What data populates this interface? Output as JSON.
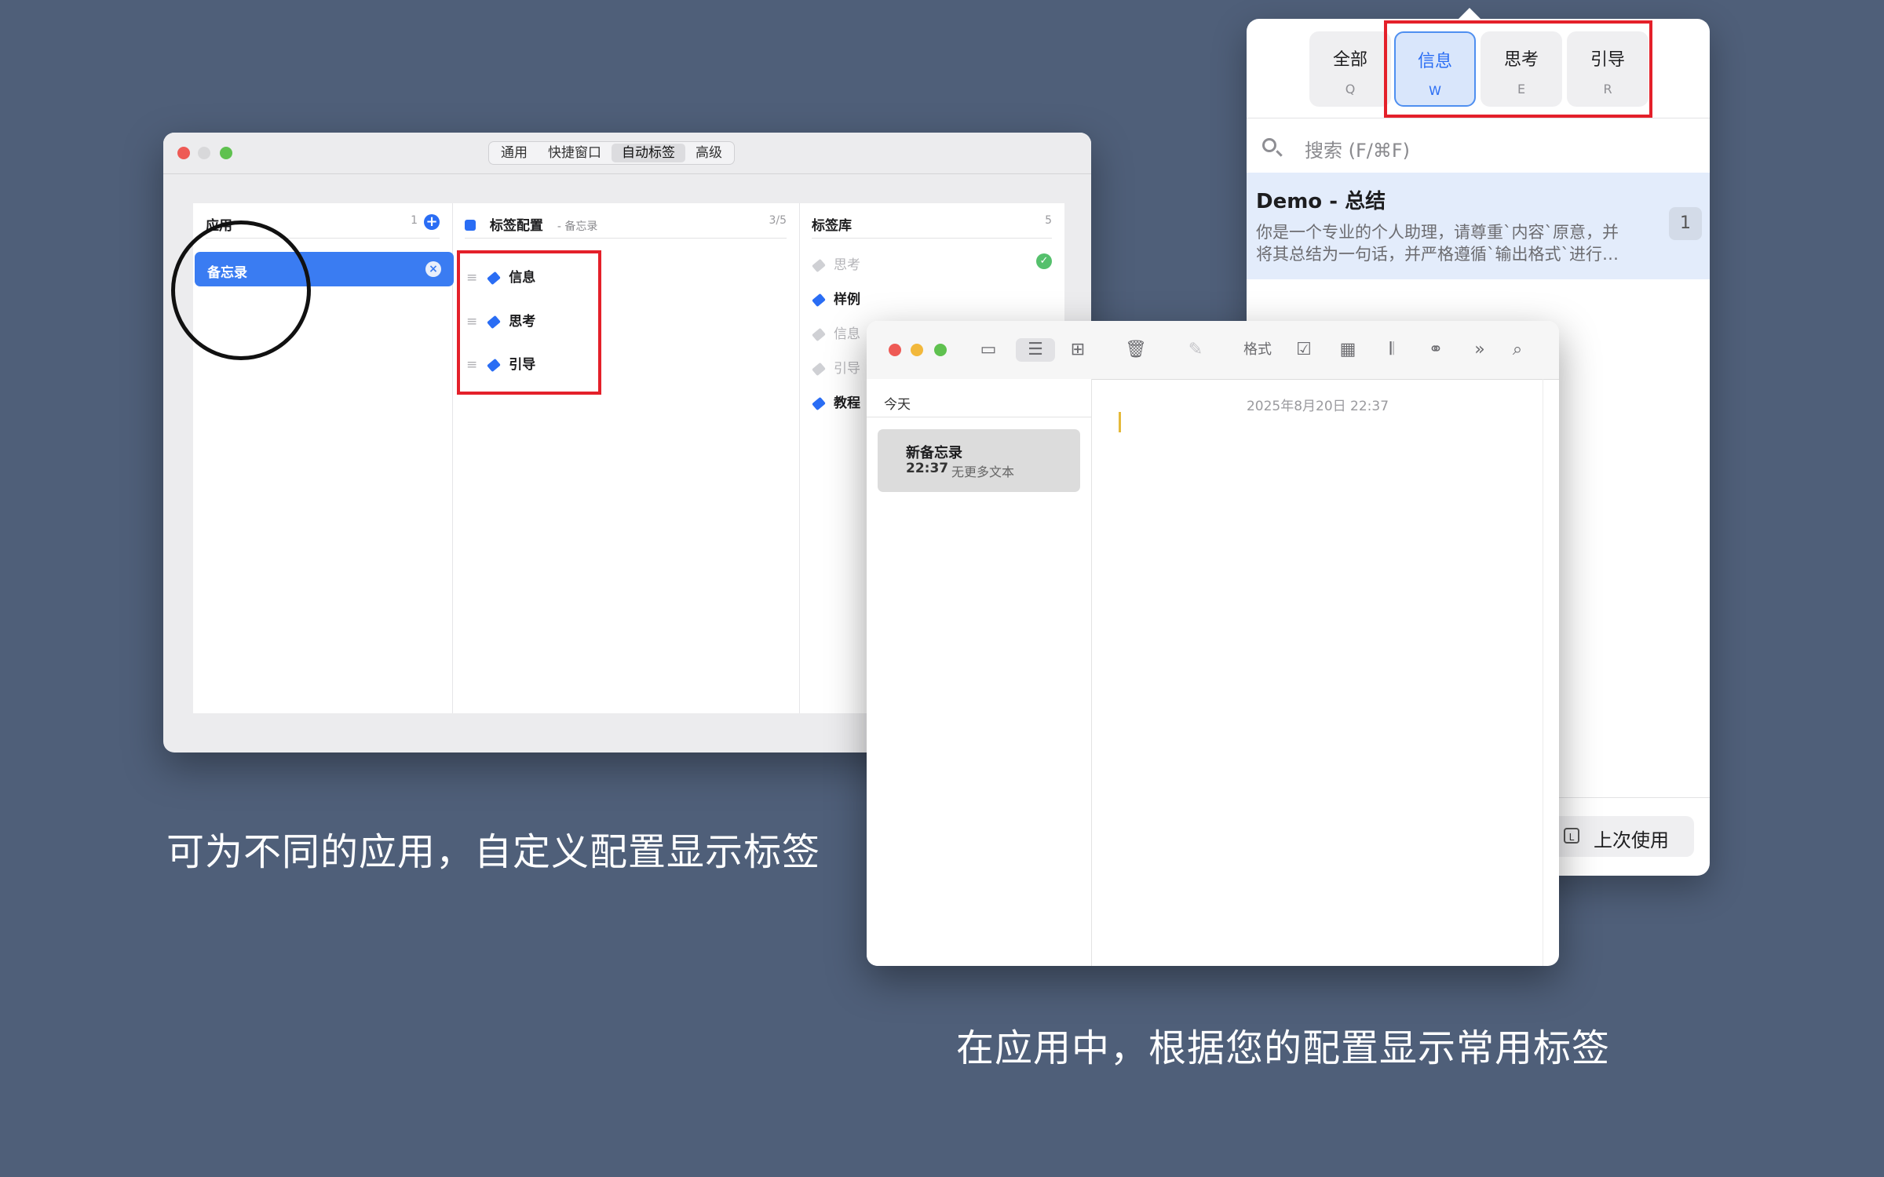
{
  "captions": {
    "left": "可为不同的应用，自定义配置显示标签",
    "right": "在应用中，根据您的配置显示常用标签"
  },
  "settings_window": {
    "tabs": [
      {
        "label": "通用",
        "active": false
      },
      {
        "label": "快捷窗口",
        "active": false
      },
      {
        "label": "自动标签",
        "active": true
      },
      {
        "label": "高级",
        "active": false
      }
    ],
    "apps_column": {
      "title": "应用",
      "count": "1",
      "add_icon": "plus-icon",
      "selected_app": "备忘录"
    },
    "config_column": {
      "title": "标签配置",
      "subtitle": "- 备忘录",
      "count": "3/5",
      "tags": [
        "信息",
        "思考",
        "引导"
      ]
    },
    "library_column": {
      "title": "标签库",
      "count": "5",
      "items": [
        {
          "label": "思考",
          "dim": true,
          "checked": true
        },
        {
          "label": "样例",
          "dim": false
        },
        {
          "label": "信息",
          "dim": true
        },
        {
          "label": "引导",
          "dim": true
        },
        {
          "label": "教程",
          "dim": false
        }
      ]
    },
    "accent_color": "#3a7cf2",
    "highlight_color": "#e4202a"
  },
  "popover": {
    "tabs": [
      {
        "label": "全部",
        "key": "Q",
        "active": false
      },
      {
        "label": "信息",
        "key": "W",
        "active": true
      },
      {
        "label": "思考",
        "key": "E",
        "active": false
      },
      {
        "label": "引导",
        "key": "R",
        "active": false
      }
    ],
    "search_placeholder": "搜索 (F/⌘F)",
    "prompt": {
      "title": "Demo - 总结",
      "desc_line1": "你是一个专业的个人助理，请尊重`内容`原意，并",
      "desc_line2": "将其总结为一句话，并严格遵循`输出格式`进行…",
      "badge": "1"
    },
    "last_used_key": "L",
    "last_used_label": "上次使用"
  },
  "notes_window": {
    "toolbar_format_label": "格式",
    "section_label": "今天",
    "note": {
      "title": "新备忘录",
      "time": "22:37",
      "preview": "无更多文本"
    },
    "date_header": "2025年8月20日 22:37"
  }
}
